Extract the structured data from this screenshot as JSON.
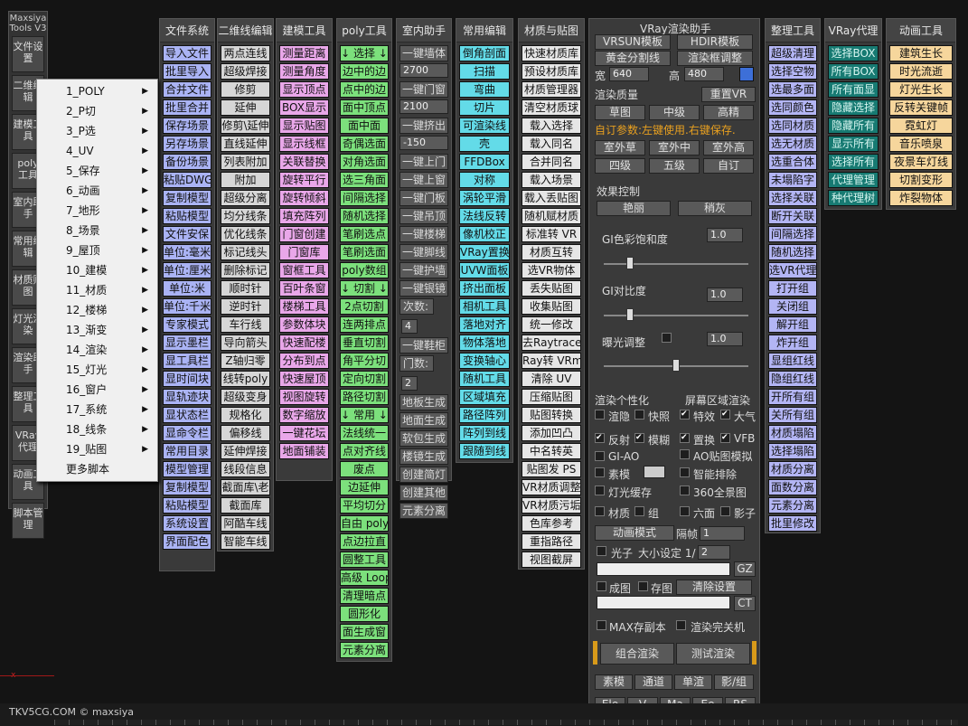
{
  "left_toolbar": {
    "title": "Maxsiya Tools V3",
    "items": [
      "文件设置",
      "二维编辑",
      "建模工具",
      "poly工具",
      "室内助手",
      "常用编辑",
      "材质贴图",
      "灯光渲染",
      "渲染助手",
      "整理工具",
      "VRay代理",
      "动画工具",
      "脚本管理"
    ]
  },
  "popup": {
    "items": [
      "1_POLY",
      "2_P切",
      "3_P选",
      "4_UV",
      "5_保存",
      "6_动画",
      "7_地形",
      "8_场景",
      "9_屋顶",
      "10_建模",
      "11_材质",
      "12_楼梯",
      "13_渐变",
      "14_渲染",
      "15_灯光",
      "16_窗户",
      "17_系统",
      "18_线条",
      "19_贴图"
    ],
    "more": "更多脚本"
  },
  "col1": {
    "header": "文件系统",
    "items": [
      "导入文件",
      "批里导入",
      "合并文件",
      "批里合并",
      "保存场景",
      "另存场景",
      "备份场景",
      "粘贴DWG",
      "复制模型",
      "粘贴模型",
      "文件安保",
      "单位:毫米",
      "单位:厘米",
      "单位:米",
      "单位:千米",
      "专家模式",
      "显示墨栏",
      "显工具栏",
      "显时间块",
      "显轨迹块",
      "显状态栏",
      "显命令栏",
      "常用目录",
      "模型管理",
      "复制模型",
      "粘贴模型",
      "系统设置",
      "界面配色"
    ]
  },
  "col2": {
    "header": "二维线编辑",
    "items": [
      "两点连线",
      "超级焊接",
      "修剪",
      "延伸",
      "修剪\\延伸",
      "直线延伸",
      "列表附加",
      "附加",
      "超级分离",
      "均分线条",
      "优化线条",
      "标记线头",
      "删除标记",
      "顺时针",
      "逆时针",
      "车行线",
      "导向箭头",
      "Z轴归零",
      "线转poly",
      "超级变身",
      "规格化",
      "偏移线",
      "延伸焊接",
      "线段信息",
      "截面库\\老",
      "截面库",
      "阿酷车线",
      "智能车线"
    ]
  },
  "col3": {
    "header": "建模工具",
    "items": [
      "测量距离",
      "测量角度",
      "显示顶点",
      "BOX显示",
      "显示贴图",
      "显示线框",
      "关联替换",
      "旋转平行",
      "旋转倾斜",
      "填充阵列",
      "门窗创建",
      "门窗库",
      "窗框工具",
      "百叶条窗",
      "楼梯工具",
      "参数体块",
      "快速配楼",
      "分布到点",
      "快速屋顶",
      "视图旋转",
      "数字缩放",
      "一键花坛",
      "地面铺装"
    ]
  },
  "col4": {
    "header": "poly工具",
    "items": [
      "↓ 选择 ↓",
      "边中的边",
      "点中的边",
      "面中顶点",
      "面中面",
      "奇偶选面",
      "对角选面",
      "选三角面",
      "间隔选择",
      "随机选择",
      "笔刷选点",
      "笔刷选面",
      "poly数组",
      "↓ 切割 ↓",
      "2点切割",
      "连两排点",
      "垂直切割",
      "角平分切",
      "定向切割",
      "路径切割",
      "↓ 常用 ↓",
      "法线统一",
      "点对齐线",
      "废点",
      "边延伸",
      "平均切分",
      "自由 poly",
      "点边拉直",
      "圆整工具",
      "高级 Loop",
      "清理暗点",
      "圆形化",
      "面生成窗",
      "元素分离"
    ]
  },
  "col5": {
    "header": "室内助手",
    "items": [
      "一键墙体",
      "2700",
      "一键门窗",
      "2100",
      "一键挤出",
      "-150",
      "一键上门",
      "一键上窗",
      "一键门板",
      "一键吊顶",
      "一键楼梯",
      "一键脚线",
      "一键护墙",
      "一键银镜",
      "次数:",
      "4",
      "一键鞋柜",
      "门数:",
      "2",
      "地板生成",
      "地面生成",
      "软包生成",
      "楼镜生成",
      "创建简灯",
      "创建其他",
      "元素分离"
    ]
  },
  "col6": {
    "header": "常用编辑",
    "items": [
      "倒角剖面",
      "扫描",
      "弯曲",
      "切片",
      "可渲染线",
      "壳",
      "FFDBox",
      "对称",
      "涡轮平滑",
      "法线反转",
      "像机校正",
      "VRay置换",
      "UVW面板",
      "挤出面板",
      "相机工具",
      "落地对齐",
      "物体落地",
      "变换轴心",
      "随机工具",
      "区域填充",
      "路径阵列",
      "阵列到线",
      "跟随到线"
    ]
  },
  "col7": {
    "header": "材质与贴图",
    "items": [
      "快速材质库",
      "预设材质库",
      "材质管理器",
      "清空材质球",
      "载入选择",
      "载入同名",
      "合并同名",
      "载入场景",
      "载入丢贴图",
      "随机赋材质",
      "标准转 VR",
      "材质互转",
      "选VR物体",
      "丢失贴图",
      "收集贴图",
      "统一修改",
      "去Raytrace",
      "Ray转 VRmap",
      "清除 UV",
      "压缩贴图",
      "贴图转换",
      "添加凹凸",
      "中名转英",
      "贴图发 PS",
      "VR材质调整",
      "VR材质污垢",
      "色库参考",
      "重指路径",
      "视图截屏"
    ]
  },
  "col8": {
    "header": "整理工具",
    "items": [
      "超级清理",
      "选择空物",
      "选最多面",
      "选同颜色",
      "选同材质",
      "选无材质",
      "选重合体",
      "未塌陷字",
      "选择关联",
      "断开关联",
      "间隔选择",
      "随机选择",
      "选VR代理",
      "打开组",
      "关闭组",
      "解开组",
      "炸开组",
      "显组红线",
      "隐组红线",
      "开所有组",
      "关所有组",
      "材质塌陷",
      "选择塌陷",
      "材质分离",
      "面数分离",
      "元素分离",
      "批里修改"
    ]
  },
  "col9": {
    "header": "VRay代理",
    "items": [
      "选择BOX",
      "所有BOX",
      "所有面显",
      "隐藏选择",
      "隐藏所有",
      "显示所有",
      "选择所有",
      "代理管理",
      "种代理树"
    ]
  },
  "col10": {
    "header": "动画工具",
    "items": [
      "建筑生长",
      "时光流逝",
      "灯光生长",
      "反转关键帧",
      "霓虹灯",
      "音乐喷泉",
      "夜景车灯线",
      "切割变形",
      "炸裂物体"
    ]
  },
  "vray": {
    "title": "VRay渲染助手",
    "row1": [
      "VRSUN模板",
      "HDIR模板"
    ],
    "row2": [
      "黄金分割线",
      "渲染框调整"
    ],
    "width_label": "宽",
    "width": "640",
    "height_label": "高",
    "height": "480",
    "quality_label": "渲染质量",
    "reset": "重置VR",
    "q1": [
      "草图",
      "中级",
      "高精"
    ],
    "tip": "自订参数:左键使用.右键保存.",
    "q2": [
      "室外草",
      "室外中",
      "室外高"
    ],
    "q3": [
      "四级",
      "五级",
      "自订"
    ],
    "effect_label": "效果控制",
    "effect": [
      "艳丽",
      "稍灰"
    ],
    "gi_sat": "GI色彩饱和度",
    "gi_sat_val": "1.0",
    "gi_sat_level": 0.18,
    "gi_con": "GI对比度",
    "gi_con_val": "1.0",
    "gi_con_level": 0.18,
    "exp": "曝光调整",
    "exp_val": "1.0",
    "exp_level": 0.5,
    "personal": "渲染个性化",
    "screen": "屏幕区域渲染",
    "cb1": [
      "渲隐",
      "快照",
      "特效",
      "大气"
    ],
    "cb2": [
      "反射",
      "模糊",
      "置换",
      "VFB"
    ],
    "gi_ao": "GI-AO",
    "ao_map": "AO贴图模拟",
    "sumo": "素模",
    "smart": "智能排除",
    "light_cache": "灯光缓存",
    "pano": "360全景图",
    "cb3": [
      "材质",
      "组",
      "六面",
      "影子"
    ],
    "anim": "动画模式",
    "interval": "隔帧",
    "interval_val": "1",
    "photon": "光子",
    "size": "大小设定 1/",
    "size_val": "2",
    "gz": "GZ",
    "img": "成图",
    "save": "存图",
    "clear": "清除设置",
    "ct": "CT",
    "max_save": "MAX存副本",
    "shutdown": "渲染完关机",
    "combo": "组合渲染",
    "test": "测试渲染",
    "bt1": [
      "素模",
      "通道",
      "单渲",
      "影/组"
    ],
    "bt2": [
      "Ele",
      "V",
      "Ma",
      "Ee",
      "RS"
    ]
  },
  "footer": "TKV5CG.COM © maxsiya"
}
